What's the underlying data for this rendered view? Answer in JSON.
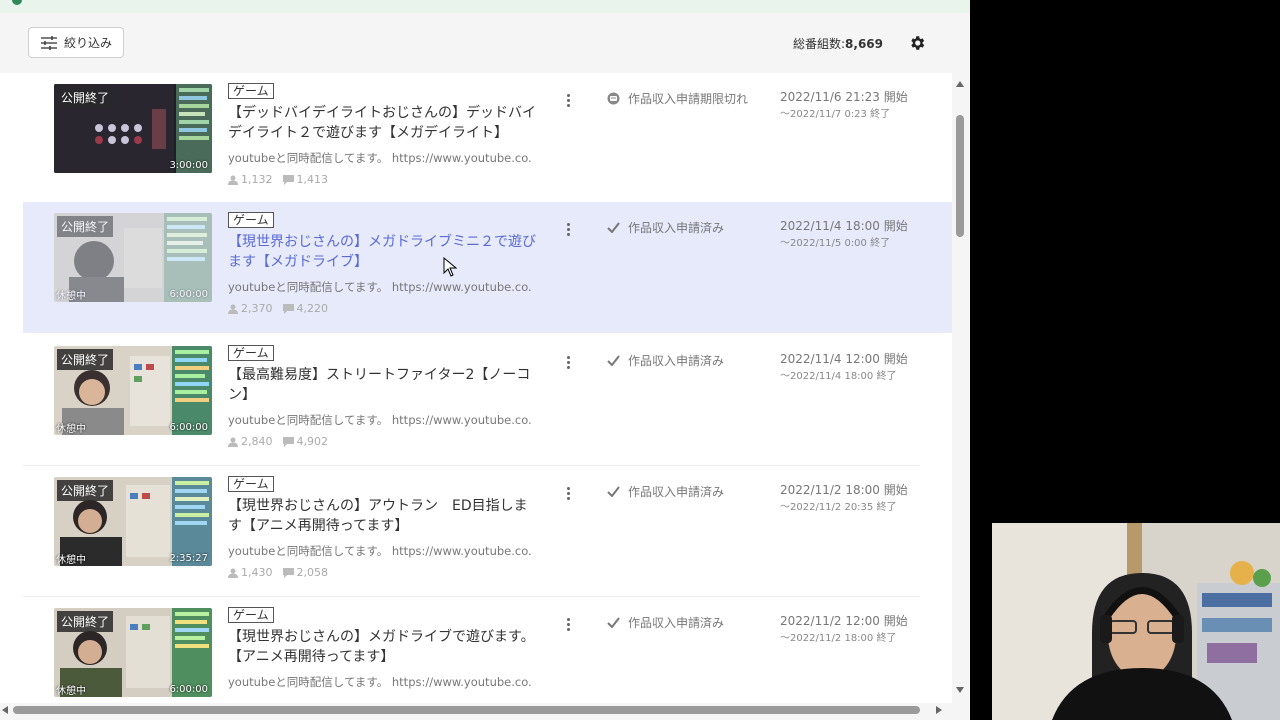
{
  "toolbar": {
    "filter_label": "絞り込み",
    "total_label": "総番組数:",
    "total_value": "8,669"
  },
  "rows": [
    {
      "status_label": "公開終了",
      "duration": "3:00:00",
      "rest_label": "",
      "tag": "ゲーム",
      "title": "【デッドバイデイライトおじさんの】デッドバイデイライト２で遊びます【メガデイライト】",
      "desc": "youtubeと同時配信してます。 https://www.youtube.co...",
      "viewers": "1,132",
      "comments": "1,413",
      "review_status": "作品収入申請期限切れ",
      "review_icon": "expired-icon",
      "start": "2022/11/6 21:23 開始",
      "end": "～2022/11/7 0:23 終了"
    },
    {
      "status_label": "公開終了",
      "duration": "6:00:00",
      "rest_label": "休憩中",
      "tag": "ゲーム",
      "title": "【現世界おじさんの】メガドライブミニ２で遊びます【メガドライブ】",
      "desc": "youtubeと同時配信してます。 https://www.youtube.co...",
      "viewers": "2,370",
      "comments": "4,220",
      "review_status": "作品収入申請済み",
      "review_icon": "check-icon",
      "start": "2022/11/4 18:00 開始",
      "end": "～2022/11/5 0:00 終了"
    },
    {
      "status_label": "公開終了",
      "duration": "6:00:00",
      "rest_label": "休憩中",
      "tag": "ゲーム",
      "title": "【最高難易度】ストリートファイター2【ノーコン】",
      "desc": "youtubeと同時配信してます。 https://www.youtube.co...",
      "viewers": "2,840",
      "comments": "4,902",
      "review_status": "作品収入申請済み",
      "review_icon": "check-icon",
      "start": "2022/11/4 12:00 開始",
      "end": "～2022/11/4 18:00 終了"
    },
    {
      "status_label": "公開終了",
      "duration": "2:35:27",
      "rest_label": "休憩中",
      "tag": "ゲーム",
      "title": "【現世界おじさんの】アウトラン　ED目指します【アニメ再開待ってます】",
      "desc": "youtubeと同時配信してます。 https://www.youtube.co...",
      "viewers": "1,430",
      "comments": "2,058",
      "review_status": "作品収入申請済み",
      "review_icon": "check-icon",
      "start": "2022/11/2 18:00 開始",
      "end": "～2022/11/2 20:35 終了"
    },
    {
      "status_label": "公開終了",
      "duration": "6:00:00",
      "rest_label": "休憩中",
      "tag": "ゲーム",
      "title": "【現世界おじさんの】メガドライブで遊びます。【アニメ再開待ってます】",
      "desc": "youtubeと同時配信してます。 https://www.youtube.co...",
      "viewers": "",
      "comments": "",
      "review_status": "作品収入申請済み",
      "review_icon": "check-icon",
      "start": "2022/11/2 12:00 開始",
      "end": "～2022/11/2 18:00 終了"
    }
  ],
  "colors": {
    "selected_row": "#e6eafb",
    "selected_title": "#5b6bd6",
    "accent_green": "#2e8b57"
  }
}
